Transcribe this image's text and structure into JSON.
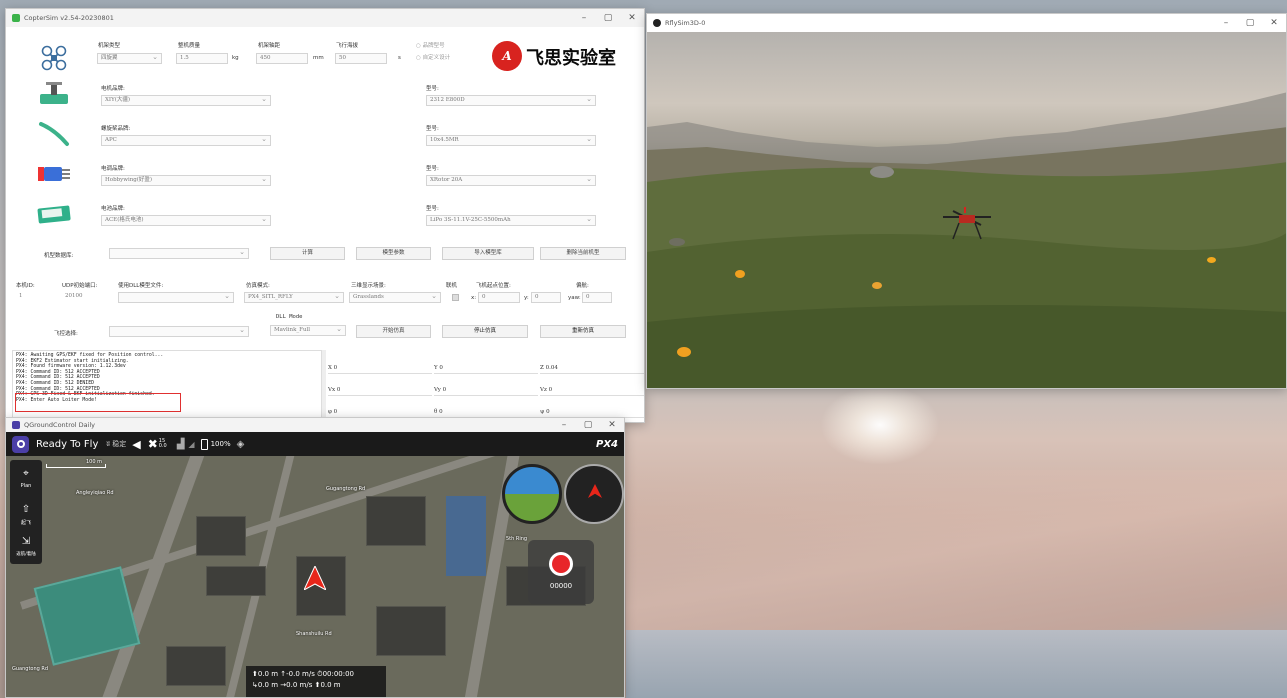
{
  "colors": {
    "qgc_toolbar": "#1a1a1a",
    "logo_red": "#d8231f",
    "alert_red": "#e03030",
    "record_red": "#e8262a",
    "grass": "#5d6b3c"
  },
  "coptersim": {
    "title": "CopterSim v2.54-20230801",
    "logo_text": "飞思实验室",
    "frame": {
      "type_label": "机架类型",
      "type_value": "四旋翼",
      "mass_label": "整机质量",
      "mass_value": "1.5",
      "mass_unit": "kg",
      "wheelbase_label": "机架轴距",
      "wheelbase_value": "450",
      "wheelbase_unit": "mm",
      "altitude_label": "飞行海拔",
      "altitude_value": "50",
      "altitude_unit": "s",
      "radio_brand": "品牌型号",
      "radio_custom": "自定义设计"
    },
    "components": [
      {
        "brand_label": "电机品牌:",
        "brand_value": "XIY(大疆)",
        "model_label": "型号:",
        "model_value": "2312 E800D",
        "icon": "motor-icon"
      },
      {
        "brand_label": "螺旋桨品牌:",
        "brand_value": "APC",
        "model_label": "型号:",
        "model_value": "10x4.5MR",
        "icon": "propeller-icon"
      },
      {
        "brand_label": "电调品牌:",
        "brand_value": "Hobbywing(好盈)",
        "model_label": "型号:",
        "model_value": "XRotor 20A",
        "icon": "esc-icon"
      },
      {
        "brand_label": "电池品牌:",
        "brand_value": "ACE(格氏电池)",
        "model_label": "型号:",
        "model_value": "LiPo 3S-11.1V-25C-5500mAh",
        "icon": "battery-icon"
      }
    ],
    "model_row": {
      "label": "机型数据库:",
      "calc": "计算",
      "model_params": "模型参数",
      "import": "导入模型库",
      "delete": "删除当前机型"
    },
    "sim_row": {
      "copter_id_label": "本机ID:",
      "copter_id": "1",
      "udp_port_label": "UDP初始端口:",
      "udp_port": "20100",
      "dll_label": "使用DLL模型文件:",
      "sim_mode_label": "仿真模式:",
      "sim_mode": "PX4_SITL_RFLY",
      "scene_label": "三维显示场景:",
      "scene": "Grasslands",
      "offline_label": "联机",
      "takeoff_label": "飞机起点位置:",
      "x_label": "x:",
      "x_value": "0",
      "y_label": "y:",
      "y_value": "0",
      "heading_label": "偏航:",
      "yaw_label": "yaw:",
      "yaw_value": "0"
    },
    "dll_mode": {
      "label": "DLL Mode",
      "value": "Mavlink_Full"
    },
    "control_row": {
      "label": "飞控选择:",
      "start": "开始仿真",
      "stop": "停止仿真",
      "restart": "重新仿真"
    },
    "log": [
      "PX4: Awaiting GPS/EKF fixed for Position control...",
      "PX4: EKF2 Estimator start initializing.",
      "PX4: Found firmware version: 1.12.3dev",
      "PX4: Command ID: 512 ACCEPTED",
      "PX4: Command ID: 512 ACCEPTED",
      "PX4: Command ID: 512 DENIED",
      "PX4: Command ID: 512 ACCEPTED",
      "PX4: GPS 3D Fixed & EKF initialization finished.",
      "PX4: Enter Auto Loiter Mode!"
    ],
    "position": {
      "x_label": "X",
      "x": "0",
      "y_label": "Y",
      "y": "0",
      "z_label": "Z",
      "z": "0.04",
      "vx_label": "Vx",
      "vx": "0",
      "vy_label": "Vy",
      "vy": "0",
      "vz_label": "Vz",
      "vz": "0",
      "phi_label": "φ",
      "phi": "0",
      "theta_label": "θ",
      "theta": "0",
      "psi_label": "ψ",
      "psi": "0"
    }
  },
  "rflysim": {
    "title": "RflySim3D-0"
  },
  "qgc": {
    "title": "QGroundControl Daily",
    "status": "Ready To Fly",
    "gps_count": "15",
    "hdop": "0.0",
    "battery": "100%",
    "brand": "PX4",
    "signal": "稳定",
    "tools": [
      {
        "icon": "plan-icon",
        "label": "Plan"
      },
      {
        "icon": "takeoff-icon",
        "label": "起飞"
      },
      {
        "icon": "rtl-icon",
        "label": "返航/着陆"
      }
    ],
    "record_timer": "00000",
    "telemetry": {
      "alt1": "0.0 m",
      "vs": "-0.0 m/s",
      "time": "00:00:00",
      "dist": "0.0 m",
      "hs": "0.0 m/s",
      "alt2": "0.0 m"
    },
    "scale": "100 m",
    "map_labels": [
      "Angleyiqiao Rd",
      "Gugangtong Rd",
      "Shanshuilu Rd",
      "5th Ring",
      "Guangtong Rd"
    ]
  }
}
